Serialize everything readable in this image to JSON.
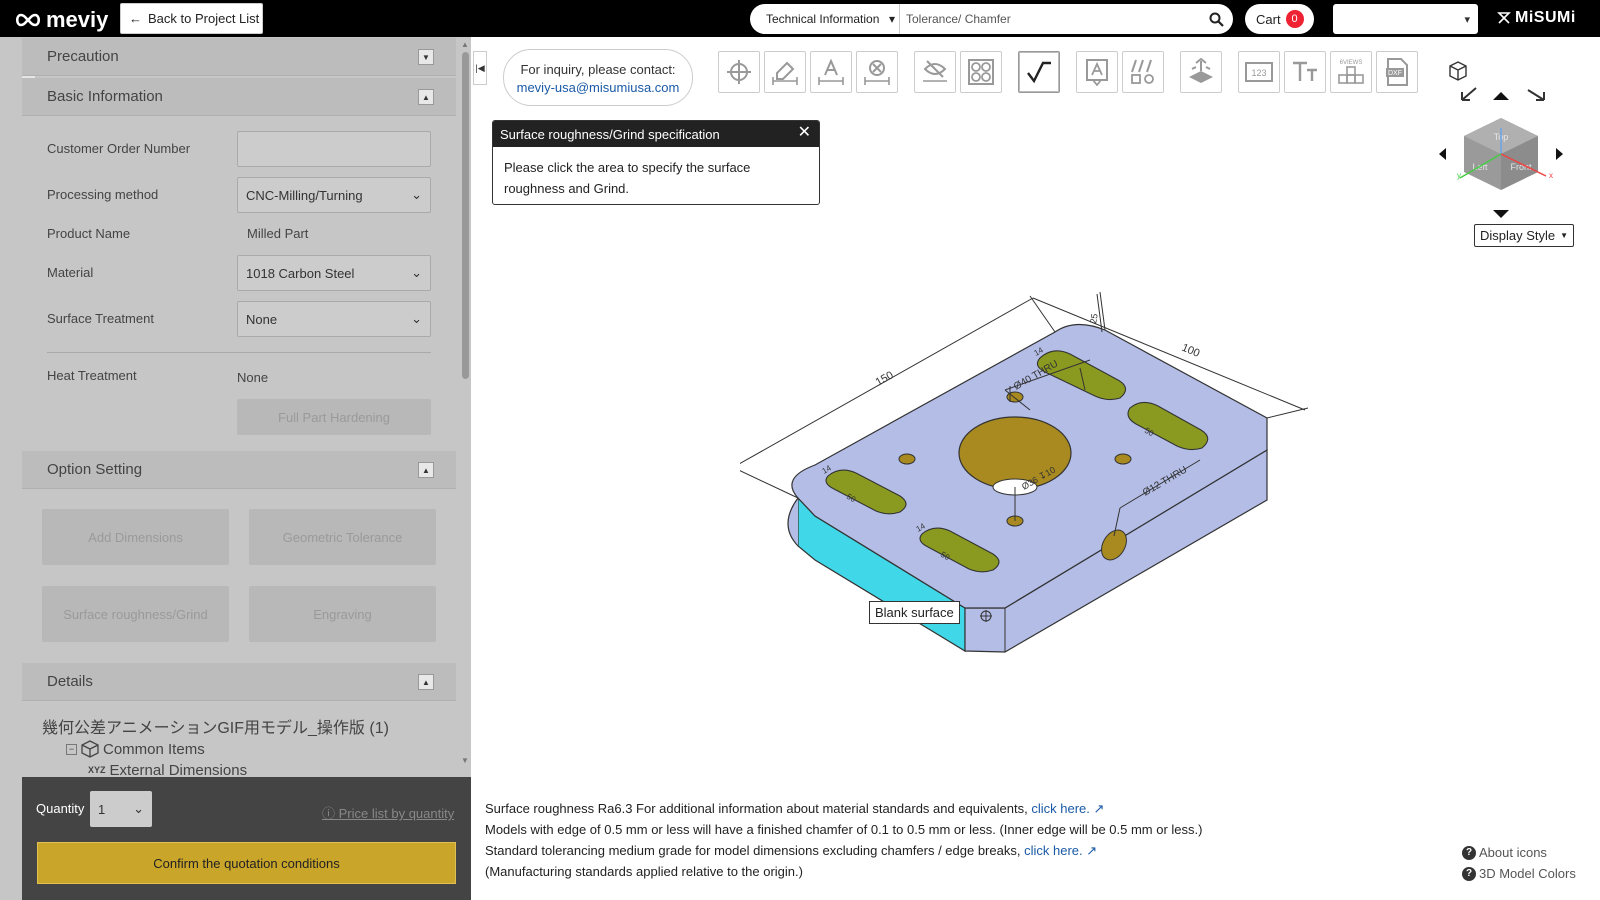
{
  "topbar": {
    "logo": "meviy",
    "back_label": "Back to Project List",
    "search_category": "Technical Information",
    "search_placeholder": "Tolerance/ Chamfer",
    "cart_label": "Cart",
    "cart_count": "0",
    "brand": "MiSUMi"
  },
  "sidebar": {
    "sections": {
      "precaution": "Precaution",
      "basic_info": "Basic Information",
      "option_setting": "Option Setting",
      "details": "Details"
    },
    "fields": {
      "customer_order_label": "Customer Order Number",
      "customer_order_value": "",
      "processing_label": "Processing method",
      "processing_value": "CNC-Milling/Turning",
      "product_name_label": "Product Name",
      "product_name_value": "Milled Part",
      "material_label": "Material",
      "material_value": "1018 Carbon Steel",
      "surface_label": "Surface Treatment",
      "surface_value": "None",
      "heat_label": "Heat Treatment",
      "heat_value": "None",
      "hardening_button": "Full Part Hardening"
    },
    "options": {
      "add_dimensions": "Add Dimensions",
      "geometric_tolerance": "Geometric Tolerance",
      "surface_roughness": "Surface roughness/Grind",
      "engraving": "Engraving"
    },
    "details": {
      "model_name": "幾何公差アニメーションGIF用モデル_操作版 (1)",
      "common_items": "Common Items",
      "external_dimensions": "External Dimensions"
    }
  },
  "quantity": {
    "label": "Quantity",
    "value": "1",
    "price_link": "Price list by quantity",
    "confirm_button": "Confirm the quotation conditions"
  },
  "viewer": {
    "inquiry_line1": "For inquiry, please contact:",
    "inquiry_email": "meviy-usa@misumiusa.com",
    "popup_title": "Surface roughness/Grind specification",
    "popup_body": "Please click the area to specify the surface roughness and Grind.",
    "blank_surface_tip": "Blank surface",
    "display_style": "Display Style",
    "cube_labels": {
      "top": "Top",
      "left": "Left",
      "front": "Front"
    },
    "dims": {
      "length": "150",
      "width": "100",
      "height": "25",
      "thru1": "Ø40 THRU",
      "thru2": "Ø12 THRU",
      "cbore": "Ø36 ↧10",
      "slot_a": "14",
      "slot_b": "50"
    },
    "tools": [
      "origin-icon",
      "edit-dimension-icon",
      "text-dimension-icon",
      "delete-dimension-icon",
      "hide-dimension-icon",
      "hole-group-icon",
      "surface-roughness-icon",
      "text-note-icon",
      "tolerance-icon",
      "grind-icon",
      "numbering-icon",
      "font-icon",
      "views-icon",
      "dxf-icon"
    ]
  },
  "notes": {
    "line1_a": "Surface roughness Ra6.3    For additional information about material standards and equivalents,",
    "line1_link": "click here.",
    "line2": "Models with edge of 0.5 mm or less will have a finished chamfer of 0.1 to 0.5 mm or less. (Inner edge will be 0.5 mm or less.)",
    "line3_a": "Standard tolerancing medium grade for model dimensions excluding chamfers / edge breaks,",
    "line3_link": "click here.",
    "line4": "(Manufacturing standards applied relative to the origin.)",
    "about_icons": "About icons",
    "model_colors": "3D Model Colors"
  },
  "colors": {
    "part_top": "#b3bde6",
    "part_side": "#3fd6e6",
    "hole": "#a88a20",
    "slot": "#8a9a20",
    "confirm": "#c9a52a"
  }
}
